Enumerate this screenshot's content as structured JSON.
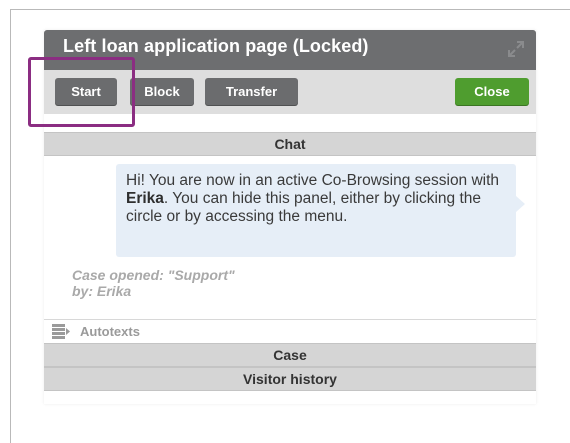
{
  "panel": {
    "title": "Left loan application page (Locked)",
    "icons": {
      "expand": "expand-icon",
      "autotexts": "list-icon"
    }
  },
  "toolbar": {
    "start_label": "Start",
    "block_label": "Block",
    "transfer_label": "Transfer",
    "close_label": "Close"
  },
  "sections": {
    "chat": "Chat",
    "case": "Case",
    "visitor_history": "Visitor history"
  },
  "chat": {
    "message_prefix": "Hi! You are now in an active Co-Browsing session with ",
    "message_agent": "Erika",
    "message_suffix": ". You can hide this panel, either by clicking the circle or by accessing the menu.",
    "system_line1": "Case opened: \"Support\"",
    "system_line2": "by: Erika"
  },
  "autotexts_label": "Autotexts",
  "colors": {
    "titlebar": "#6d6e70",
    "button": "#6b6c6e",
    "close_button": "#4f9d2f",
    "highlight": "#8b2d82",
    "bubble": "#e6eef7"
  }
}
